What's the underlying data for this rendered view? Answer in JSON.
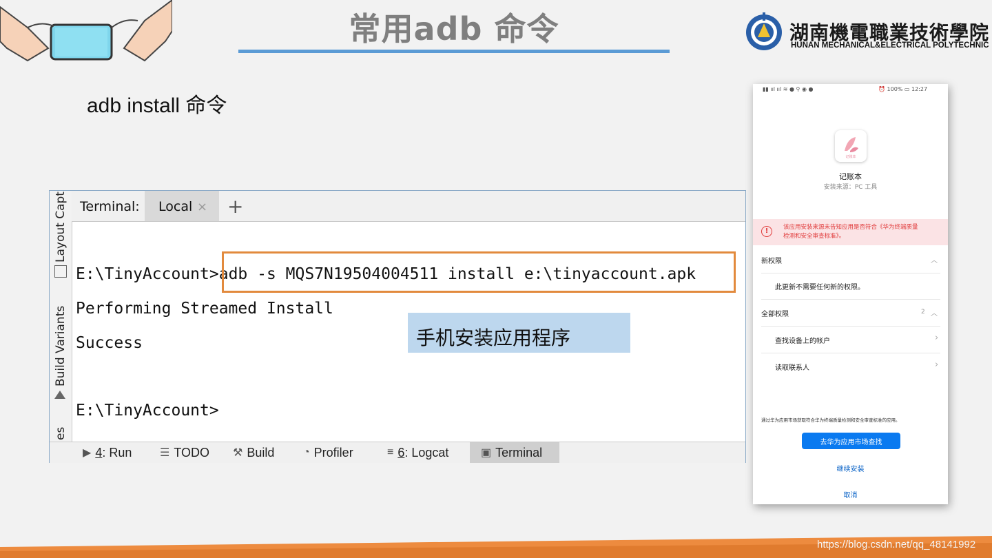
{
  "header": {
    "title": "常用adb 命令",
    "school_cn": "湖南機電職業技術學院",
    "school_en": "HUNAN MECHANICAL&ELECTRICAL POLYTECHNIC"
  },
  "subtitle": "adb install 命令",
  "ide": {
    "side_labels": [
      "Layout Capt",
      "Build Variants",
      "es"
    ],
    "tab_bar_label": "Terminal:",
    "tab_local": "Local",
    "tab_close": "×",
    "tab_add": "+",
    "terminal_lines": [
      {
        "prompt": "E:\\TinyAccount>",
        "cmd": "adb -s MQS7N19504004511 install e:\\tinyaccount.apk"
      },
      {
        "text": "Performing Streamed Install"
      },
      {
        "text": "Success"
      },
      {
        "prompt": "E:\\TinyAccount>",
        "cmd": ""
      }
    ],
    "annotation": "手机安装应用程序",
    "bottom_tools": [
      {
        "key": "4",
        "label": ": Run"
      },
      {
        "label": "TODO"
      },
      {
        "label": "Build"
      },
      {
        "label": "Profiler"
      },
      {
        "key": "6",
        "label": ": Logcat"
      },
      {
        "label": "Terminal",
        "active": true
      }
    ]
  },
  "phone": {
    "status_right": "100%",
    "time": "12:27",
    "app_name": "记账本",
    "app_icon_text": "记账本",
    "source": "安装来源：PC 工具",
    "warning": "该应用安装来源未告知应用是否符合《华为终端质量检测和安全审查标准》。",
    "new_perm_title": "新权限",
    "new_perm_desc": "此更新不需要任何新的权限。",
    "all_perm_title": "全部权限",
    "all_perm_count": "2",
    "perm_items": [
      "查找设备上的帐户",
      "读取联系人"
    ],
    "market_note": "通过华为应用市场获取符合华为终端质量检测和安全审查标准的应用。",
    "market_button": "去华为应用市场查找",
    "continue": "继续安装",
    "cancel": "取消"
  },
  "footer": {
    "watermark": "https://blog.csdn.net/qq_48141992"
  },
  "colors": {
    "accent_line": "#5b9bd5",
    "highlight_box": "#e28a3d",
    "annotation_bg": "#bdd7ee",
    "phone_button": "#0a7af0",
    "footer": "#ed8b3f"
  }
}
